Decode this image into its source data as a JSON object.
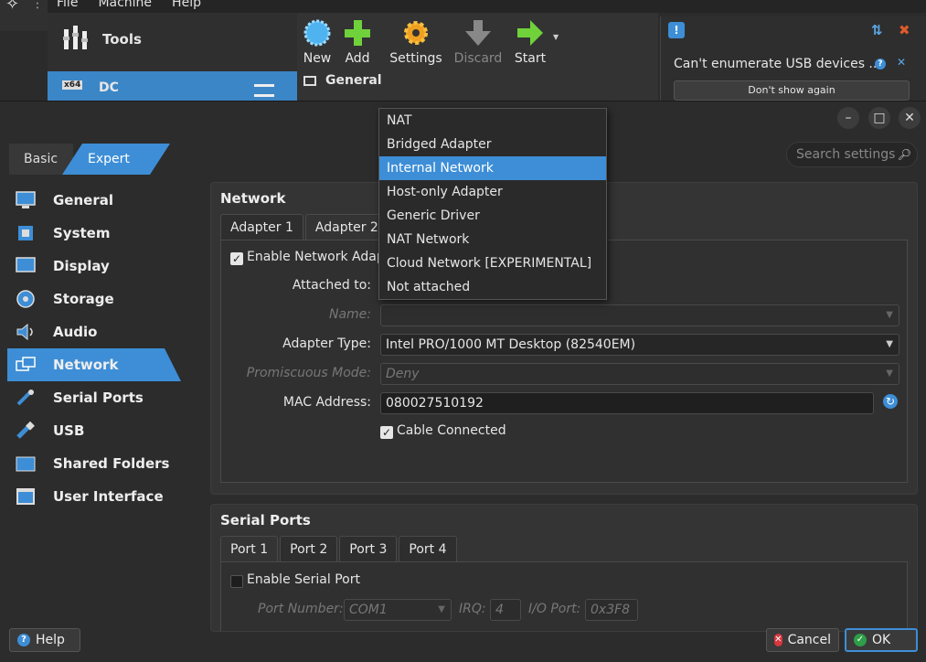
{
  "app": {
    "menu": [
      "File",
      "Machine",
      "Help"
    ],
    "tools_label": "Tools",
    "vm_name": "DC",
    "vm_arch_badge": "x64",
    "toolbar": {
      "new_label": "New",
      "add_label": "Add",
      "settings_label": "Settings",
      "discard_label": "Discard",
      "start_label": "Start"
    },
    "details_section": "General",
    "notification": {
      "message": "Can't enumerate USB devices ...",
      "dont_show_label": "Don't show again"
    }
  },
  "dialog": {
    "mode_tabs": {
      "basic": "Basic",
      "expert": "Expert"
    },
    "search_placeholder": "Search settings",
    "nav": [
      {
        "label": "General",
        "icon": "monitor-icon"
      },
      {
        "label": "System",
        "icon": "chip-icon"
      },
      {
        "label": "Display",
        "icon": "display-icon"
      },
      {
        "label": "Storage",
        "icon": "disk-icon"
      },
      {
        "label": "Audio",
        "icon": "speaker-icon"
      },
      {
        "label": "Network",
        "icon": "network-icon"
      },
      {
        "label": "Serial Ports",
        "icon": "serial-icon"
      },
      {
        "label": "USB",
        "icon": "usb-icon"
      },
      {
        "label": "Shared Folders",
        "icon": "folder-icon"
      },
      {
        "label": "User Interface",
        "icon": "ui-icon"
      }
    ],
    "active_nav": "Network",
    "network": {
      "title": "Network",
      "tabs": [
        "Adapter 1",
        "Adapter 2"
      ],
      "enable_label": "Enable Network Adapter",
      "attached_to_label": "Attached to:",
      "name_label": "Name:",
      "name_value": "",
      "adapter_type_label": "Adapter Type:",
      "adapter_type_value": "Intel PRO/1000 MT Desktop (82540EM)",
      "promiscuous_label": "Promiscuous Mode:",
      "promiscuous_value": "Deny",
      "mac_label": "MAC Address:",
      "mac_value": "080027510192",
      "cable_label": "Cable Connected"
    },
    "attach_options": [
      "NAT",
      "Bridged Adapter",
      "Internal Network",
      "Host-only Adapter",
      "Generic Driver",
      "NAT Network",
      "Cloud Network [EXPERIMENTAL]",
      "Not attached"
    ],
    "attach_selected": "Internal Network",
    "serial": {
      "title": "Serial Ports",
      "tabs": [
        "Port 1",
        "Port 2",
        "Port 3",
        "Port 4"
      ],
      "enable_label": "Enable Serial Port",
      "port_number_label": "Port Number:",
      "port_number_value": "COM1",
      "irq_label": "IRQ:",
      "irq_value": "4",
      "io_port_label": "I/O Port:",
      "io_port_value": "0x3F8"
    },
    "footer": {
      "help_label": "Help",
      "cancel_label": "Cancel",
      "ok_label": "OK"
    }
  },
  "colors": {
    "accent": "#3d8ed6",
    "background": "#2c2c2c"
  }
}
